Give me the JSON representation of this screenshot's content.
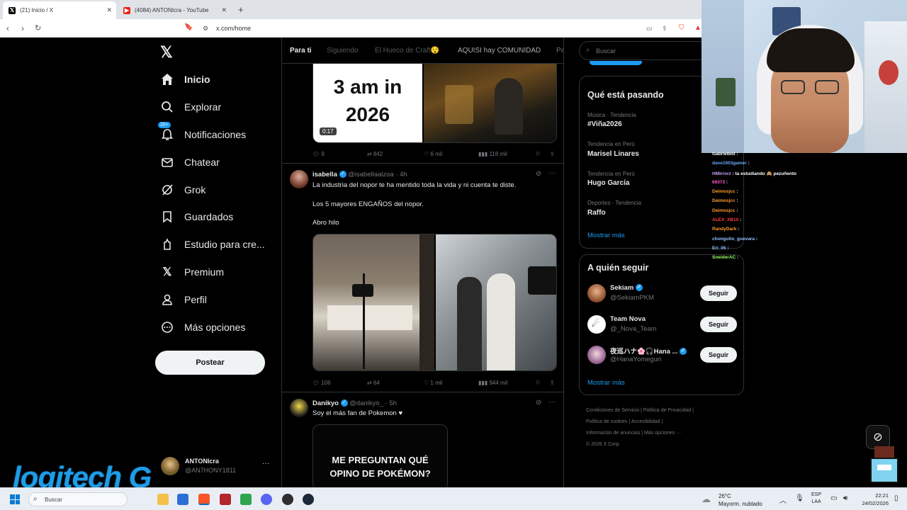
{
  "browser": {
    "tabs": [
      {
        "title": "(21) Inicio / X",
        "active": true
      },
      {
        "title": "(4084) ANTONIcra - YouTube",
        "active": false
      }
    ],
    "new_tab": "+",
    "url": "x.com/home"
  },
  "x": {
    "nav": [
      {
        "label": "Inicio",
        "icon": "home-icon"
      },
      {
        "label": "Explorar",
        "icon": "search-icon"
      },
      {
        "label": "Notificaciones",
        "icon": "bell-icon",
        "badge": "20+"
      },
      {
        "label": "Chatear",
        "icon": "mail-icon"
      },
      {
        "label": "Grok",
        "icon": "grok-icon"
      },
      {
        "label": "Guardados",
        "icon": "bookmark-icon"
      },
      {
        "label": "Estudio para cre...",
        "icon": "creator-icon"
      },
      {
        "label": "Premium",
        "icon": "x-logo-icon"
      },
      {
        "label": "Perfil",
        "icon": "user-icon"
      },
      {
        "label": "Más opciones",
        "icon": "more-circle-icon"
      }
    ],
    "post_button": "Postear",
    "account": {
      "name": "ANTONIcra",
      "handle": "@AN7HONY1811"
    },
    "feed_tabs": [
      "Para ti",
      "Siguiendo",
      "El Hueco de Craft😯",
      "AQUISI hay COMUNIDAD",
      "Pa"
    ],
    "posts": [
      {
        "media_text": [
          "3 am in",
          "2026"
        ],
        "duration": "0:17",
        "replies": "9",
        "reposts": "842",
        "likes": "6 mil",
        "views": "118 mil"
      },
      {
        "name": "isabella",
        "handle": "@isabellaalzoa",
        "time": "· 4h",
        "text1": "La industria del nopor te ha mentido toda la vida y ni cuenta te diste.",
        "text2": "Los 5 mayores ENGAÑOS del nopor.",
        "text3": "Abro hilo",
        "replies": "106",
        "reposts": "64",
        "likes": "1 mil",
        "views": "944 mil"
      },
      {
        "name": "Danikyo",
        "handle": "@danikyo_",
        "time": "· 5h",
        "text1": "Soy el más fan de Pokemon ♥",
        "media_text": [
          "ME PREGUNTAN QUÉ",
          "OPINO DE POKÉMON?"
        ]
      }
    ],
    "search_placeholder": "Buscar",
    "trends_title": "Qué está pasando",
    "trends": [
      {
        "context": "Música · Tendencia",
        "name": "#Viña2026"
      },
      {
        "context": "Tendencia en Perú",
        "name": "Marisel Linares"
      },
      {
        "context": "Tendencia en Perú",
        "name": "Hugo García"
      },
      {
        "context": "Deportes · Tendencia",
        "name": "Raffo"
      }
    ],
    "show_more": "Mostrar más",
    "follow_title": "A quién seguir",
    "follow": [
      {
        "name": "Sekiam",
        "handle": "@SekiamPKM",
        "button": "Seguir"
      },
      {
        "name": "Team Nova",
        "handle": "@_Nova_Team",
        "button": "Seguir"
      },
      {
        "name": "夜巡ハナ🌸🎧Hana ...",
        "handle": "@HanaYomeguri",
        "button": "Seguir"
      }
    ],
    "footer": [
      "Condiciones de Servicio",
      "Política de Privacidad",
      "Política de cookies",
      "Accesibilidad",
      "Información de anuncios",
      "Más opciones ···",
      "© 2026 X Corp."
    ]
  },
  "chat": [
    {
      "user": "Gabrielbot",
      "msg": ":",
      "color": "#ffffff"
    },
    {
      "user": "dave1003gamer",
      "msg": ":",
      "color": "#6ea8ff"
    },
    {
      "user": "HMirrorz",
      "msg": ": ta estudiando 🙈 pezuñento",
      "color": "#c9a0ff"
    },
    {
      "user": "69373",
      "msg": ":",
      "color": "#ff5ad1"
    },
    {
      "user": "Deimosjcc",
      "msg": ":",
      "color": "#ff9a2e"
    },
    {
      "user": "Deimosjcc",
      "msg": ":",
      "color": "#ff9a2e"
    },
    {
      "user": "Deimosjcc",
      "msg": ":",
      "color": "#ff9a2e"
    },
    {
      "user": "ALEX_XB10",
      "msg": ":",
      "color": "#ff3b3b"
    },
    {
      "user": "RandyDark",
      "msg": ":",
      "color": "#ff9a2e"
    },
    {
      "user": "chonguito_guevara",
      "msg": ":",
      "color": "#8fc2ff"
    },
    {
      "user": "Eri_05",
      "msg": ":",
      "color": "#8fc2ff"
    },
    {
      "user": "SneiderAC",
      "msg": ":",
      "color": "#9cff6b"
    }
  ],
  "overlay_logo": "logitech G",
  "taskbar": {
    "search": "Buscar",
    "weather_temp": "26°C",
    "weather_desc": "Mayorm. nublado",
    "lang1": "ESP",
    "lang2": "LAA",
    "time": "22:21",
    "date": "24/02/2026"
  },
  "colors": {
    "accent": "#1d9bf0",
    "bg": "#000000",
    "text": "#e7e9ea",
    "muted": "#71767b"
  }
}
